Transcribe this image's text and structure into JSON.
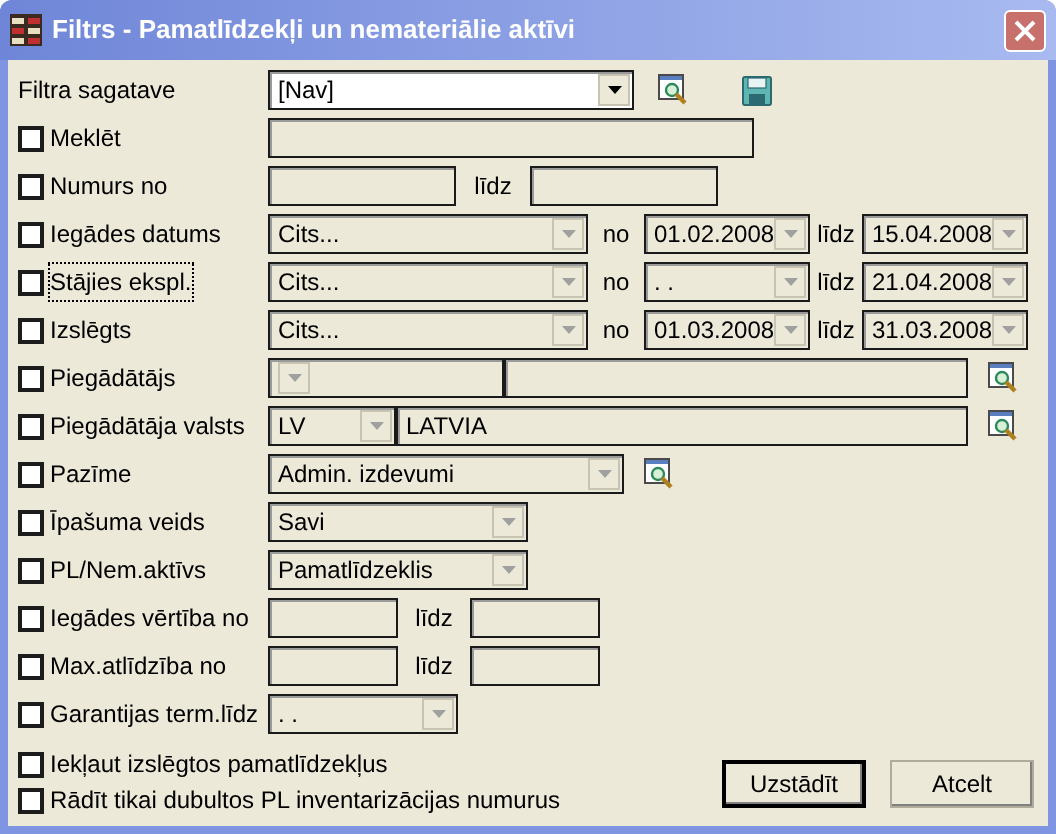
{
  "window": {
    "title": "Filtrs - Pamatlīdzekļi un nemateriālie aktīvi"
  },
  "rows": [
    {
      "kind": "template",
      "label": "Filtra sagatave",
      "value": "[Nav]"
    },
    {
      "kind": "text",
      "label": "Meklēt",
      "checked": false,
      "focused": false
    },
    {
      "kind": "number-range",
      "label": "Numurs no",
      "checked": false,
      "focused": false,
      "to_label": "līdz"
    },
    {
      "kind": "date-range",
      "label": "Iegādes datums",
      "checked": false,
      "focused": false,
      "period": "Cits...",
      "from_label": "no",
      "from": "01.02.2008",
      "to_label": "līdz",
      "to": "15.04.2008"
    },
    {
      "kind": "date-range",
      "label": "Stājies ekspl.",
      "checked": false,
      "focused": true,
      "period": "Cits...",
      "from_label": "no",
      "from": ". .",
      "to_label": "līdz",
      "to": "21.04.2008"
    },
    {
      "kind": "date-range",
      "label": "Izslēgts",
      "checked": false,
      "focused": false,
      "period": "Cits...",
      "from_label": "no",
      "from": "01.03.2008",
      "to_label": "līdz",
      "to": "31.03.2008"
    },
    {
      "kind": "lookup",
      "label": "Piegādātājs",
      "checked": false,
      "focused": false
    },
    {
      "kind": "country",
      "label": "Piegādātāja valsts",
      "checked": false,
      "focused": false,
      "code": "LV",
      "name": "LATVIA"
    },
    {
      "kind": "lookup-combo",
      "label": "Pazīme",
      "checked": false,
      "focused": false,
      "value": "Admin. izdevumi"
    },
    {
      "kind": "combo",
      "label": "Īpašuma veids",
      "checked": false,
      "focused": false,
      "value": "Savi"
    },
    {
      "kind": "combo",
      "label": "PL/Nem.aktīvs",
      "checked": false,
      "focused": false,
      "value": "Pamatlīdzeklis"
    },
    {
      "kind": "amount-range",
      "label": "Iegādes vērtība no",
      "checked": false,
      "focused": false,
      "to_label": "līdz"
    },
    {
      "kind": "amount-range",
      "label": "Max.atlīdzība no",
      "checked": false,
      "focused": false,
      "to_label": "līdz"
    },
    {
      "kind": "date",
      "label": "Garantijas term.līdz",
      "checked": false,
      "focused": false,
      "value": ". ."
    }
  ],
  "options": [
    {
      "label": "Iekļaut izslēgtos pamatlīdzekļus",
      "checked": false
    },
    {
      "label": "Rādīt tikai dubultos PL inventarizācijas numurus",
      "checked": false
    }
  ],
  "buttons": [
    {
      "label": "Uzstādīt",
      "default": true
    },
    {
      "label": "Atcelt",
      "default": false
    }
  ]
}
